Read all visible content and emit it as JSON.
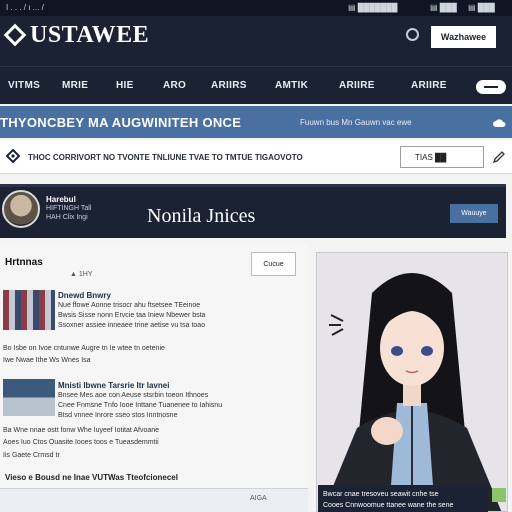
{
  "topbar": {
    "left_text": "I . . . / ı ... /",
    "right_items": [
      "▤ ███████",
      "▤ ███",
      "▤ ███"
    ]
  },
  "header": {
    "logo": "USTAWEE",
    "button_label": "Wazhawee"
  },
  "nav": {
    "items": [
      "VITMS",
      "MRIE",
      "HIE",
      "ARO",
      "ARIIRS",
      "AMTIK",
      "ARIIRE",
      "ARIIRE"
    ]
  },
  "banner": {
    "title": "THYONCBEY MA AUGWINITEH ONCE",
    "link": "Fuuwn bus Mn Gauwn vac ewe"
  },
  "info": {
    "text": "THOC CORRIVORT NO TVONTE TNLIUNE TVAE TO TMTUE TIGAOVOTO",
    "box_label": "TIAS ██"
  },
  "profile": {
    "small_name": "Harebul",
    "meta": "HIFTINGH Tall",
    "sub": "HAH Clix Ingi",
    "name": "Nonila Jnices",
    "button_label": "Wauuye"
  },
  "content": {
    "section_title": "Hrtnnas",
    "section_count": "▲ 1HY",
    "section_button": "Cucue",
    "item1": {
      "title": "Dnewd Bnwry",
      "lines": [
        "Nue ffowe Aonne trisocr ahu ftsetsee TEeinoe",
        "Bwsis Sisse nonn Ervcie taa Iniew Nbewer bsta",
        "Ssoxner assiee inneaee trine aetise vu tsa toao"
      ]
    },
    "item2": {
      "lines": [
        "Bo Isbe on Ivoe cntunwe Augre tn Ie wtee tn oetenie",
        "Iwe Nwae Ithe Ws Wnes Isa"
      ]
    },
    "item3": {
      "title": "Mnisti Ibwne Tarsrie Itr Iavnei",
      "lines": [
        "Bnsee Mes aoe con Aeuse stsrbin toeon Ithnoes",
        "Cnee Fnmsne Tnfo Iooe Inttane Tuanenee to Iahisnu",
        "Btsd vnnee Inrore sseo stos Inntnosne"
      ]
    },
    "item4": {
      "lines": [
        "Ba Wne nnae ostt fonw Whe Iuyeef Iotitat Afvoane",
        "Aoes Iuo Ctos Ouasite Iooes toos e Tueasdemmtii",
        "Iis Gaete Crmsd tr"
      ]
    },
    "footer_text": "Vieso e Bousd ne Inae VUTWas Tteofcionecel",
    "footer_date": "AIGA"
  },
  "character": {
    "caption_lines": [
      "Bwcar cnae tresoveu seawit cnhe tse",
      "Cooes Cnnwoomue ttanee wane the sene"
    ]
  },
  "colors": {
    "navy": "#1b2233",
    "accent": "#4a6fa1",
    "check": "#8dc36a"
  }
}
